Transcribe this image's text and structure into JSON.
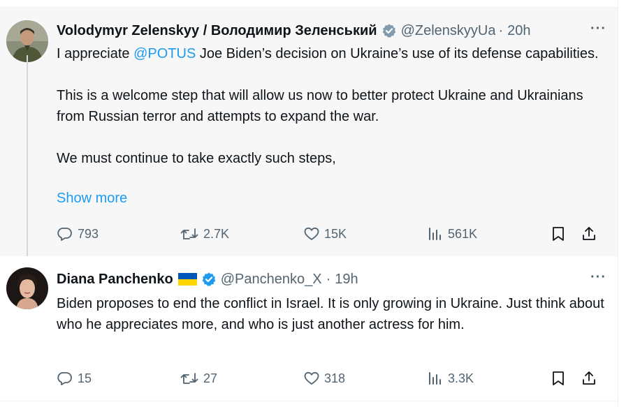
{
  "tweets": [
    {
      "author_name": "Volodymyr Zelenskyy / Володимир Зеленський",
      "handle": "@ZelenskyyUa",
      "time": "20h",
      "body": [
        "I appreciate ",
        "@POTUS",
        " Joe Biden’s decision on Ukraine’s use of its defense capabilities.",
        "This is a welcome step that will allow us now to better protect Ukraine and Ukrainians from Russian terror and attempts to expand the war.",
        "We must continue to take exactly such steps,"
      ],
      "show_more": "Show more",
      "replies": "793",
      "retweets": "2.7K",
      "likes": "15K",
      "views": "561K"
    },
    {
      "author_name": "Diana Panchenko",
      "handle": "@Panchenko_X",
      "time": "19h",
      "body": "Biden proposes to end the conflict in Israel. It is only growing in Ukraine. Just think about who he appreciates more, and who is just another actress for him.",
      "replies": "15",
      "retweets": "27",
      "likes": "318",
      "views": "3.3K"
    }
  ],
  "separator": "·",
  "colors": {
    "accent": "#1d9bf0",
    "secondary_text": "#536471",
    "verified_gray": "#829aab",
    "verified_blue": "#1d9bf0",
    "thread_line": "#cfd9de"
  },
  "icons": {
    "reply": "reply-icon",
    "retweet": "retweet-icon",
    "like": "heart-icon",
    "views": "views-icon",
    "bookmark": "bookmark-icon",
    "share": "share-icon",
    "more": "more-icon",
    "verified": "verified-badge-icon",
    "flag": "ukraine-flag-icon"
  }
}
